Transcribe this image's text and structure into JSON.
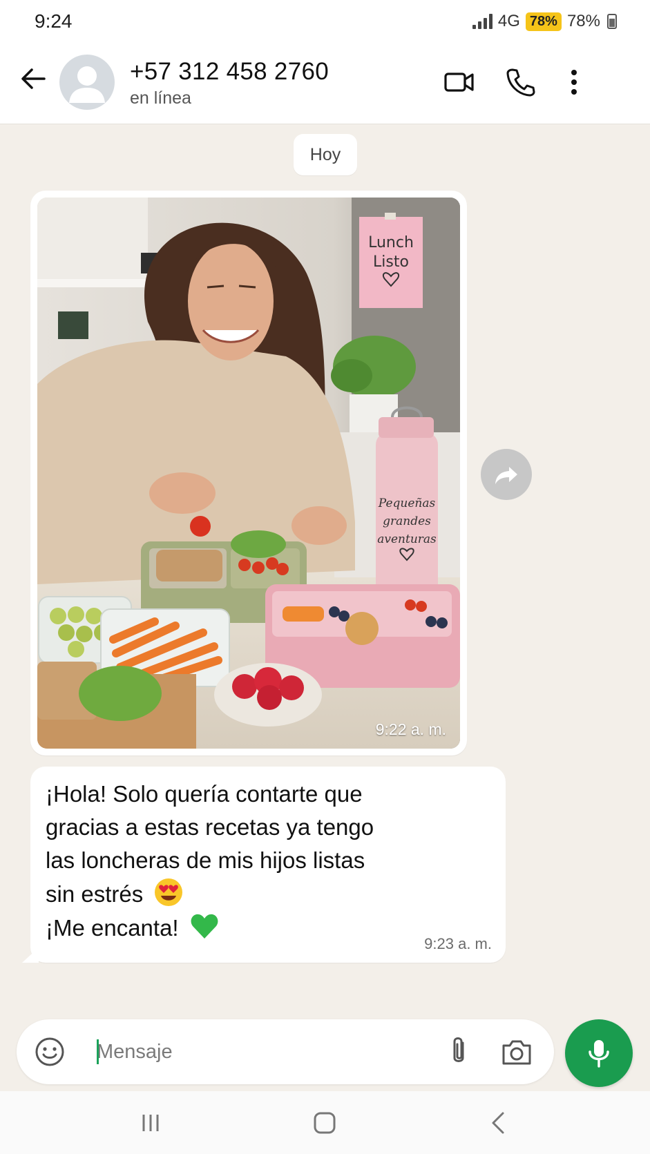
{
  "status_bar": {
    "time": "9:24",
    "network": "4G",
    "battery_badge": "78%",
    "battery_text": "78%"
  },
  "header": {
    "contact_name": "+57 312 458 2760",
    "contact_status": "en línea",
    "icons": [
      "back-arrow-icon",
      "avatar",
      "video-call-icon",
      "phone-icon",
      "more-vert-icon"
    ]
  },
  "chat": {
    "date_chip": "Hoy",
    "image_message": {
      "time": "9:22 a. m.",
      "note_text": [
        "Lunch",
        "Listo"
      ],
      "bottle_text": [
        "Pequeñas",
        "grandes",
        "aventuras"
      ]
    },
    "text_message": {
      "lines": [
        "¡Hola! Solo quería contarte que",
        "gracias a estas recetas ya tengo",
        "las loncheras de mis hijos listas",
        "sin estrés",
        "¡Me encanta!"
      ],
      "emoji_1": "heart-eyes-emoji",
      "emoji_2": "green-heart-emoji",
      "time": "9:23 a. m."
    }
  },
  "input_bar": {
    "placeholder": "Mensaje"
  },
  "colors": {
    "accent": "#1a9c4f",
    "chat_background": "#f3efe9",
    "bubble": "#ffffff",
    "battery_badge": "#f5c419"
  }
}
